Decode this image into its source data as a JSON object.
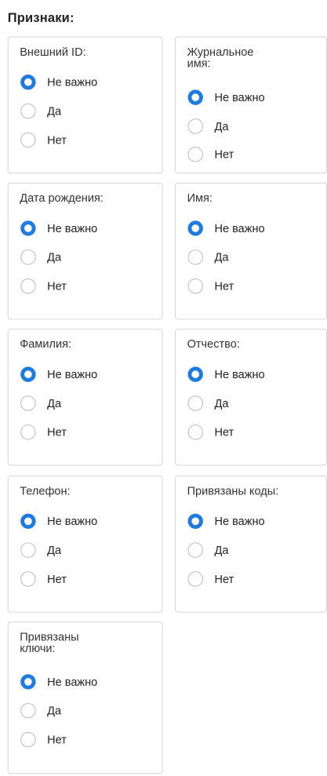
{
  "section": {
    "title": "Признаки:"
  },
  "options": {
    "any": "Не важно",
    "yes": "Да",
    "no": "Нет"
  },
  "accent_color": "#1e7be0",
  "groups": [
    {
      "key": "external-id",
      "label": "Внешний ID:",
      "selected": "any"
    },
    {
      "key": "journal-name",
      "label": "Журнальное имя:",
      "selected": "any"
    },
    {
      "key": "birth-date",
      "label": "Дата рождения:",
      "selected": "any"
    },
    {
      "key": "first-name",
      "label": "Имя:",
      "selected": "any"
    },
    {
      "key": "last-name",
      "label": "Фамилия:",
      "selected": "any"
    },
    {
      "key": "patronymic",
      "label": "Отчество:",
      "selected": "any"
    },
    {
      "key": "phone",
      "label": "Телефон:",
      "selected": "any"
    },
    {
      "key": "linked-codes",
      "label": "Привязаны коды:",
      "selected": "any"
    },
    {
      "key": "linked-keys",
      "label": "Привязаны ключи:",
      "selected": "any"
    }
  ]
}
